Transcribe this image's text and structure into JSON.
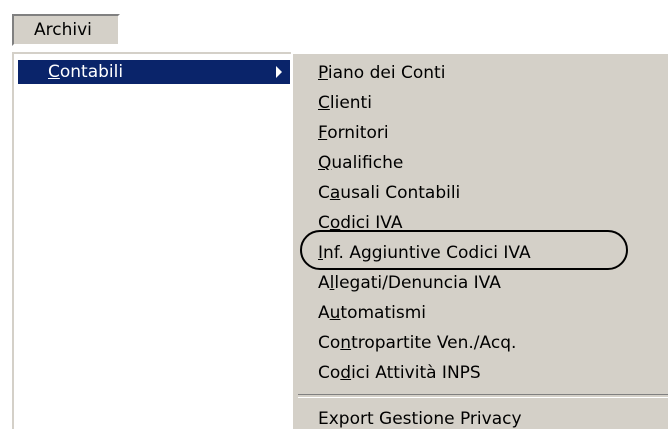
{
  "menubar": {
    "archivi_label": "Archivi"
  },
  "dropdown": {
    "contabili": {
      "first": "C",
      "rest": "ontabili"
    }
  },
  "submenu": {
    "items": [
      {
        "pre": "",
        "ul": "P",
        "post": "iano dei Conti"
      },
      {
        "pre": "",
        "ul": "C",
        "post": "lienti"
      },
      {
        "pre": "",
        "ul": "F",
        "post": "ornitori"
      },
      {
        "pre": "",
        "ul": "Q",
        "post": "ualifiche"
      },
      {
        "pre": "C",
        "ul": "a",
        "post": "usali Contabili"
      },
      {
        "pre": "C",
        "ul": "o",
        "post": "dici IVA"
      },
      {
        "pre": "",
        "ul": "I",
        "post": "nf. Aggiuntive Codici IVA"
      },
      {
        "pre": "A",
        "ul": "l",
        "post": "legati/Denuncia IVA"
      },
      {
        "pre": "A",
        "ul": "u",
        "post": "tomatismi"
      },
      {
        "pre": "Co",
        "ul": "n",
        "post": "tropartite Ven./Acq."
      },
      {
        "pre": "Co",
        "ul": "d",
        "post": "ici Attività INPS"
      }
    ],
    "export": "Export Gestione Privacy"
  }
}
